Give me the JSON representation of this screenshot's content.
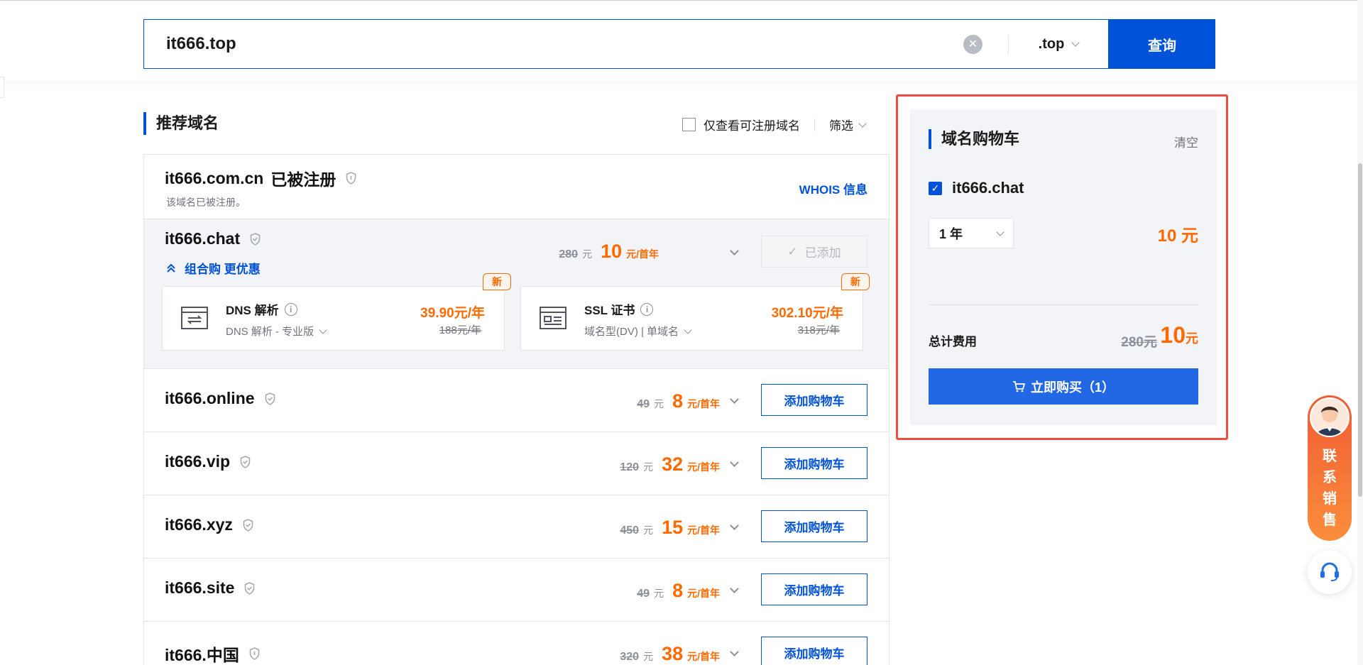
{
  "search": {
    "query": "it666.top",
    "tld": ".top",
    "button": "查询"
  },
  "section": {
    "title": "推荐域名",
    "only_available": "仅查看可注册域名",
    "filter": "筛选"
  },
  "registered": {
    "domain": "it666.com.cn",
    "status": "已被注册",
    "note": "该域名已被注册。",
    "whois": "WHOIS 信息"
  },
  "expanded": {
    "domain": "it666.chat",
    "combo": "组合购 更优惠",
    "old_price": "280",
    "old_unit": "元",
    "new_price": "10",
    "new_unit": "元/首年",
    "added": "已添加",
    "addons": [
      {
        "badge": "新",
        "title": "DNS 解析",
        "sub": "DNS 解析 - 专业版",
        "price": "39.90元/年",
        "old": "188元/年"
      },
      {
        "badge": "新",
        "title": "SSL 证书",
        "sub": "域名型(DV) | 单域名",
        "price": "302.10元/年",
        "old": "318元/年"
      }
    ]
  },
  "rows": [
    {
      "domain": "it666.online",
      "old_price": "49",
      "old_unit": "元",
      "new_price": "8",
      "new_unit": "元/首年",
      "button": "添加购物车"
    },
    {
      "domain": "it666.vip",
      "old_price": "120",
      "old_unit": "元",
      "new_price": "32",
      "new_unit": "元/首年",
      "button": "添加购物车"
    },
    {
      "domain": "it666.xyz",
      "old_price": "450",
      "old_unit": "元",
      "new_price": "15",
      "new_unit": "元/首年",
      "button": "添加购物车"
    },
    {
      "domain": "it666.site",
      "old_price": "49",
      "old_unit": "元",
      "new_price": "8",
      "new_unit": "元/首年",
      "button": "添加购物车"
    },
    {
      "domain": "it666.中国",
      "old_price": "320",
      "old_unit": "元",
      "new_price": "38",
      "new_unit": "元/首年",
      "button": "添加购物车"
    }
  ],
  "cart": {
    "title": "域名购物车",
    "clear": "清空",
    "item": "it666.chat",
    "years": "1 年",
    "price": "10 元",
    "total_label": "总计费用",
    "total_old": "280元",
    "total_new": "10",
    "total_unit": "元",
    "buy": "立即购买（1）"
  },
  "contact": {
    "label": "联系销售"
  },
  "colors": {
    "primary": "#0052d9",
    "price": "#ff6a00",
    "highlight": "#f04b42"
  }
}
